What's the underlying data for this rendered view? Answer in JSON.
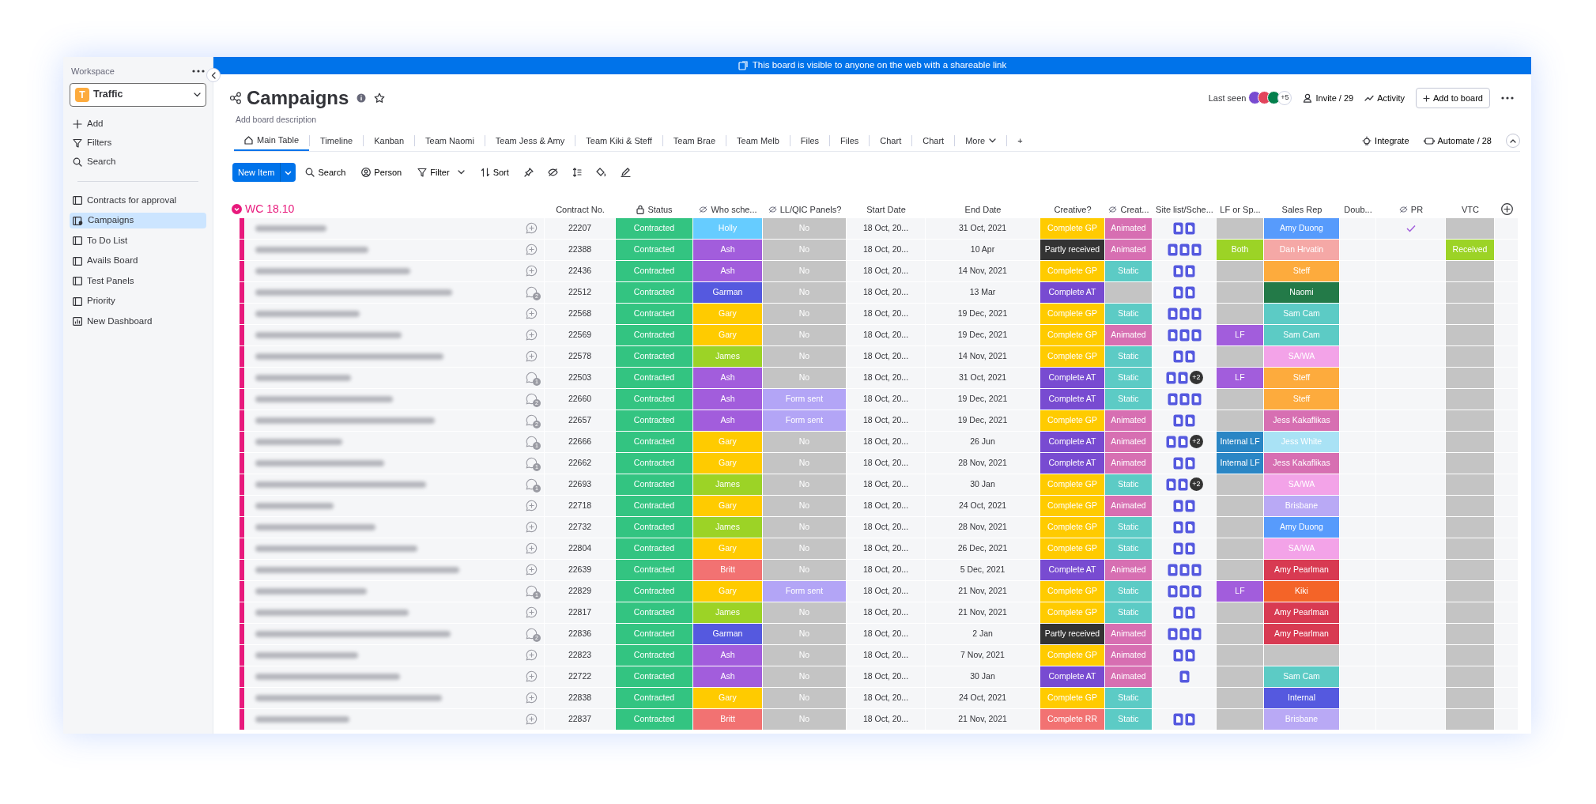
{
  "banner": "This board is visible to anyone on the web with a shareable link",
  "sidebar": {
    "heading": "Workspace",
    "workspace": {
      "badge": "T",
      "name": "Traffic"
    },
    "actions": [
      "Add",
      "Filters",
      "Search"
    ],
    "boards": [
      {
        "label": "Contracts for approval",
        "kind": "board",
        "selected": false
      },
      {
        "label": "Campaigns",
        "kind": "shared",
        "selected": true
      },
      {
        "label": "To Do List",
        "kind": "board",
        "selected": false
      },
      {
        "label": "Avails Board",
        "kind": "board",
        "selected": false
      },
      {
        "label": "Test Panels",
        "kind": "board",
        "selected": false
      },
      {
        "label": "Priority",
        "kind": "board",
        "selected": false
      },
      {
        "label": "New Dashboard",
        "kind": "dashboard",
        "selected": false
      }
    ]
  },
  "board": {
    "title": "Campaigns",
    "description": "Add board description",
    "last_seen": "Last seen",
    "avatars": [
      {
        "color": "#784bd1"
      },
      {
        "color": "#e2445c"
      },
      {
        "color": "#037f4c"
      }
    ],
    "more_viewers": "+5",
    "invite": "Invite / 29",
    "activity": "Activity",
    "add_to_board": "Add to board"
  },
  "tabs": [
    {
      "label": "Main Table",
      "selected": true,
      "kind": "home"
    },
    {
      "label": "Timeline",
      "selected": false,
      "kind": "view"
    },
    {
      "label": "Kanban",
      "selected": false,
      "kind": "view"
    },
    {
      "label": "Team Naomi",
      "selected": false,
      "kind": "view"
    },
    {
      "label": "Team Jess & Amy",
      "selected": false,
      "kind": "view"
    },
    {
      "label": "Team Kiki & Steff",
      "selected": false,
      "kind": "view"
    },
    {
      "label": "Team Brae",
      "selected": false,
      "kind": "view"
    },
    {
      "label": "Team Melb",
      "selected": false,
      "kind": "view"
    },
    {
      "label": "Files",
      "selected": false,
      "kind": "view"
    },
    {
      "label": "Files",
      "selected": false,
      "kind": "view"
    },
    {
      "label": "Chart",
      "selected": false,
      "kind": "view"
    },
    {
      "label": "Chart",
      "selected": false,
      "kind": "view"
    },
    {
      "label": "More",
      "selected": false,
      "kind": "menu"
    },
    {
      "label": "+",
      "selected": false,
      "kind": "add"
    }
  ],
  "tab_actions": [
    "Integrate",
    "Automate / 28"
  ],
  "toolbar": {
    "new_item": "New Item",
    "tools": [
      {
        "label": "Search",
        "kind": "search"
      },
      {
        "label": "Person",
        "kind": "person"
      },
      {
        "label": "Filter",
        "kind": "filter"
      },
      {
        "label": "Sort",
        "kind": "sort"
      }
    ]
  },
  "group": {
    "title": "WC 18.10",
    "color": "#e8197c"
  },
  "columns": [
    {
      "label": "Contract No."
    },
    {
      "label": "Status",
      "locked": true
    },
    {
      "label": "Who sche...",
      "private": true
    },
    {
      "label": "LL/QIC Panels?",
      "private": true
    },
    {
      "label": "Start Date"
    },
    {
      "label": "End Date"
    },
    {
      "label": "Creative?"
    },
    {
      "label": "Creat...",
      "private": true
    },
    {
      "label": "Site list/Sche..."
    },
    {
      "label": "LF or Sp..."
    },
    {
      "label": "Sales Rep"
    },
    {
      "label": "Doub..."
    },
    {
      "label": "PR",
      "private": true
    },
    {
      "label": "VTC"
    }
  ],
  "rows": [
    {
      "name_redacted": true,
      "contract": "22207",
      "status": {
        "text": "Contracted",
        "color": "#33c481"
      },
      "who": {
        "text": "Holly",
        "color": "#66ccff"
      },
      "panels": {
        "text": "No",
        "color": "#c4c4c4"
      },
      "start": "18 Oct, 20...",
      "end": "31 Oct, 2021",
      "creative": {
        "text": "Complete GP",
        "color": "#ffcb00"
      },
      "creat": {
        "text": "Animated",
        "color": "#d76fb2"
      },
      "files": [
        {
          "kind": "doc"
        },
        {
          "kind": "doc"
        }
      ],
      "lf": null,
      "sales_rep": {
        "text": "Amy Duong",
        "color": "#579bfc"
      },
      "pr_checked": true,
      "vtc": null
    },
    {
      "name_redacted": true,
      "contract": "22388",
      "status": {
        "text": "Contracted",
        "color": "#33c481"
      },
      "who": {
        "text": "Ash",
        "color": "#a25ddc"
      },
      "panels": {
        "text": "No",
        "color": "#c4c4c4"
      },
      "start": "18 Oct, 20...",
      "end": "10 Apr",
      "creative": {
        "text": "Partly received",
        "color": "#333333"
      },
      "creat": {
        "text": "Animated",
        "color": "#d76fb2"
      },
      "files": [
        {
          "kind": "doc"
        },
        {
          "kind": "doc"
        },
        {
          "kind": "doc"
        }
      ],
      "lf": {
        "text": "Both",
        "color": "#9cd326"
      },
      "sales_rep": {
        "text": "Dan Hrvatin",
        "color": "#f5a8a6"
      },
      "pr_checked": false,
      "vtc": {
        "text": "Received",
        "color": "#9cd326"
      }
    },
    {
      "name_redacted": true,
      "contract": "22436",
      "status": {
        "text": "Contracted",
        "color": "#33c481"
      },
      "who": {
        "text": "Ash",
        "color": "#a25ddc"
      },
      "panels": {
        "text": "No",
        "color": "#c4c4c4"
      },
      "start": "18 Oct, 20...",
      "end": "14 Nov, 2021",
      "creative": {
        "text": "Complete GP",
        "color": "#ffcb00"
      },
      "creat": {
        "text": "Static",
        "color": "#5ccbc5"
      },
      "files": [
        {
          "kind": "doc"
        },
        {
          "kind": "doc"
        }
      ],
      "lf": null,
      "sales_rep": {
        "text": "Steff",
        "color": "#fdab3d"
      },
      "pr_checked": false,
      "vtc": null
    },
    {
      "name_redacted": true,
      "updates": "2",
      "contract": "22512",
      "status": {
        "text": "Contracted",
        "color": "#33c481"
      },
      "who": {
        "text": "Garman",
        "color": "#5559df"
      },
      "panels": {
        "text": "No",
        "color": "#c4c4c4"
      },
      "start": "18 Oct, 20...",
      "end": "13 Mar",
      "creative": {
        "text": "Complete AT",
        "color": "#784bd1"
      },
      "creat": null,
      "files": [
        {
          "kind": "doc"
        },
        {
          "kind": "doc"
        }
      ],
      "lf": null,
      "sales_rep": {
        "text": "Naomi",
        "color": "#237a48"
      },
      "pr_checked": false,
      "vtc": null
    },
    {
      "name_redacted": true,
      "contract": "22568",
      "status": {
        "text": "Contracted",
        "color": "#33c481"
      },
      "who": {
        "text": "Gary",
        "color": "#ffcb00"
      },
      "panels": {
        "text": "No",
        "color": "#c4c4c4"
      },
      "start": "18 Oct, 20...",
      "end": "19 Dec, 2021",
      "creative": {
        "text": "Complete GP",
        "color": "#ffcb00"
      },
      "creat": {
        "text": "Static",
        "color": "#5ccbc5"
      },
      "files": [
        {
          "kind": "doc"
        },
        {
          "kind": "doc"
        },
        {
          "kind": "doc"
        }
      ],
      "lf": null,
      "sales_rep": {
        "text": "Sam Cam",
        "color": "#5ccbc5"
      },
      "pr_checked": false,
      "vtc": null
    },
    {
      "name_redacted": true,
      "contract": "22569",
      "status": {
        "text": "Contracted",
        "color": "#33c481"
      },
      "who": {
        "text": "Gary",
        "color": "#ffcb00"
      },
      "panels": {
        "text": "No",
        "color": "#c4c4c4"
      },
      "start": "18 Oct, 20...",
      "end": "19 Dec, 2021",
      "creative": {
        "text": "Complete GP",
        "color": "#ffcb00"
      },
      "creat": {
        "text": "Animated",
        "color": "#d76fb2"
      },
      "files": [
        {
          "kind": "doc"
        },
        {
          "kind": "doc"
        },
        {
          "kind": "doc"
        }
      ],
      "lf": {
        "text": "LF",
        "color": "#a25ddc"
      },
      "sales_rep": {
        "text": "Sam Cam",
        "color": "#5ccbc5"
      },
      "pr_checked": false,
      "vtc": null
    },
    {
      "name_redacted": true,
      "contract": "22578",
      "status": {
        "text": "Contracted",
        "color": "#33c481"
      },
      "who": {
        "text": "James",
        "color": "#9cd326"
      },
      "panels": {
        "text": "No",
        "color": "#c4c4c4"
      },
      "start": "18 Oct, 20...",
      "end": "14 Nov, 2021",
      "creative": {
        "text": "Complete GP",
        "color": "#ffcb00"
      },
      "creat": {
        "text": "Static",
        "color": "#5ccbc5"
      },
      "files": [
        {
          "kind": "doc"
        },
        {
          "kind": "doc"
        }
      ],
      "lf": null,
      "sales_rep": {
        "text": "SA/WA",
        "color": "#f3a3e8"
      },
      "pr_checked": false,
      "vtc": null
    },
    {
      "name_redacted": true,
      "updates": "1",
      "contract": "22503",
      "status": {
        "text": "Contracted",
        "color": "#33c481"
      },
      "who": {
        "text": "Ash",
        "color": "#a25ddc"
      },
      "panels": {
        "text": "No",
        "color": "#c4c4c4"
      },
      "start": "18 Oct, 20...",
      "end": "31 Oct, 2021",
      "creative": {
        "text": "Complete AT",
        "color": "#784bd1"
      },
      "creat": {
        "text": "Static",
        "color": "#5ccbc5"
      },
      "files": [
        {
          "kind": "doc"
        },
        {
          "kind": "doc"
        }
      ],
      "more_files": "+2",
      "lf": {
        "text": "LF",
        "color": "#a25ddc"
      },
      "sales_rep": {
        "text": "Steff",
        "color": "#fdab3d"
      },
      "pr_checked": false,
      "vtc": null
    },
    {
      "name_redacted": true,
      "updates": "2",
      "contract": "22660",
      "status": {
        "text": "Contracted",
        "color": "#33c481"
      },
      "who": {
        "text": "Ash",
        "color": "#a25ddc"
      },
      "panels": {
        "text": "Form sent",
        "color": "#b3a5f6"
      },
      "start": "18 Oct, 20...",
      "end": "19 Dec, 2021",
      "creative": {
        "text": "Complete AT",
        "color": "#784bd1"
      },
      "creat": {
        "text": "Static",
        "color": "#5ccbc5"
      },
      "files": [
        {
          "kind": "doc"
        },
        {
          "kind": "doc"
        },
        {
          "kind": "doc"
        }
      ],
      "lf": null,
      "sales_rep": {
        "text": "Steff",
        "color": "#fdab3d"
      },
      "pr_checked": false,
      "vtc": null
    },
    {
      "name_redacted": true,
      "updates": "2",
      "contract": "22657",
      "status": {
        "text": "Contracted",
        "color": "#33c481"
      },
      "who": {
        "text": "Ash",
        "color": "#a25ddc"
      },
      "panels": {
        "text": "Form sent",
        "color": "#b3a5f6"
      },
      "start": "18 Oct, 20...",
      "end": "19 Dec, 2021",
      "creative": {
        "text": "Complete GP",
        "color": "#ffcb00"
      },
      "creat": {
        "text": "Animated",
        "color": "#d76fb2"
      },
      "files": [
        {
          "kind": "doc"
        },
        {
          "kind": "doc"
        }
      ],
      "lf": null,
      "sales_rep": {
        "text": "Jess Kakaflikas",
        "color": "#d76fb2"
      },
      "pr_checked": false,
      "vtc": null
    },
    {
      "name_redacted": true,
      "updates": "1",
      "contract": "22666",
      "status": {
        "text": "Contracted",
        "color": "#33c481"
      },
      "who": {
        "text": "Gary",
        "color": "#ffcb00"
      },
      "panels": {
        "text": "No",
        "color": "#c4c4c4"
      },
      "start": "18 Oct, 20...",
      "end": "26 Jun",
      "creative": {
        "text": "Complete AT",
        "color": "#784bd1"
      },
      "creat": {
        "text": "Animated",
        "color": "#d76fb2"
      },
      "files": [
        {
          "kind": "doc"
        },
        {
          "kind": "doc"
        }
      ],
      "more_files": "+2",
      "lf": {
        "text": "Internal LF",
        "color": "#2a86c5"
      },
      "sales_rep": {
        "text": "Jess White",
        "color": "#a9e2f5"
      },
      "pr_checked": false,
      "vtc": null
    },
    {
      "name_redacted": true,
      "updates": "1",
      "contract": "22662",
      "status": {
        "text": "Contracted",
        "color": "#33c481"
      },
      "who": {
        "text": "Gary",
        "color": "#ffcb00"
      },
      "panels": {
        "text": "No",
        "color": "#c4c4c4"
      },
      "start": "18 Oct, 20...",
      "end": "28 Nov, 2021",
      "creative": {
        "text": "Complete AT",
        "color": "#784bd1"
      },
      "creat": {
        "text": "Animated",
        "color": "#d76fb2"
      },
      "files": [
        {
          "kind": "doc"
        },
        {
          "kind": "doc"
        }
      ],
      "lf": {
        "text": "Internal LF",
        "color": "#2a86c5"
      },
      "sales_rep": {
        "text": "Jess Kakaflikas",
        "color": "#d76fb2"
      },
      "pr_checked": false,
      "vtc": null
    },
    {
      "name_redacted": true,
      "updates": "1",
      "contract": "22693",
      "status": {
        "text": "Contracted",
        "color": "#33c481"
      },
      "who": {
        "text": "James",
        "color": "#9cd326"
      },
      "panels": {
        "text": "No",
        "color": "#c4c4c4"
      },
      "start": "18 Oct, 20...",
      "end": "30 Jan",
      "creative": {
        "text": "Complete GP",
        "color": "#ffcb00"
      },
      "creat": {
        "text": "Static",
        "color": "#5ccbc5"
      },
      "files": [
        {
          "kind": "doc"
        },
        {
          "kind": "doc"
        }
      ],
      "more_files": "+2",
      "lf": null,
      "sales_rep": {
        "text": "SA/WA",
        "color": "#f3a3e8"
      },
      "pr_checked": false,
      "vtc": null
    },
    {
      "name_redacted": true,
      "contract": "22718",
      "status": {
        "text": "Contracted",
        "color": "#33c481"
      },
      "who": {
        "text": "Gary",
        "color": "#ffcb00"
      },
      "panels": {
        "text": "No",
        "color": "#c4c4c4"
      },
      "start": "18 Oct, 20...",
      "end": "24 Oct, 2021",
      "creative": {
        "text": "Complete GP",
        "color": "#ffcb00"
      },
      "creat": {
        "text": "Animated",
        "color": "#d76fb2"
      },
      "files": [
        {
          "kind": "doc"
        },
        {
          "kind": "doc"
        }
      ],
      "lf": null,
      "sales_rep": {
        "text": "Brisbane",
        "color": "#b9a9f5"
      },
      "pr_checked": false,
      "vtc": null
    },
    {
      "name_redacted": true,
      "contract": "22732",
      "status": {
        "text": "Contracted",
        "color": "#33c481"
      },
      "who": {
        "text": "James",
        "color": "#9cd326"
      },
      "panels": {
        "text": "No",
        "color": "#c4c4c4"
      },
      "start": "18 Oct, 20...",
      "end": "28 Nov, 2021",
      "creative": {
        "text": "Complete GP",
        "color": "#ffcb00"
      },
      "creat": {
        "text": "Static",
        "color": "#5ccbc5"
      },
      "files": [
        {
          "kind": "doc"
        },
        {
          "kind": "doc"
        }
      ],
      "lf": null,
      "sales_rep": {
        "text": "Amy Duong",
        "color": "#579bfc"
      },
      "pr_checked": false,
      "vtc": null
    },
    {
      "name_redacted": true,
      "contract": "22804",
      "status": {
        "text": "Contracted",
        "color": "#33c481"
      },
      "who": {
        "text": "Gary",
        "color": "#ffcb00"
      },
      "panels": {
        "text": "No",
        "color": "#c4c4c4"
      },
      "start": "18 Oct, 20...",
      "end": "26 Dec, 2021",
      "creative": {
        "text": "Complete GP",
        "color": "#ffcb00"
      },
      "creat": {
        "text": "Static",
        "color": "#5ccbc5"
      },
      "files": [
        {
          "kind": "doc"
        },
        {
          "kind": "doc"
        }
      ],
      "lf": null,
      "sales_rep": {
        "text": "SA/WA",
        "color": "#f3a3e8"
      },
      "pr_checked": false,
      "vtc": null
    },
    {
      "name_redacted": true,
      "contract": "22639",
      "status": {
        "text": "Contracted",
        "color": "#33c481"
      },
      "who": {
        "text": "Britt",
        "color": "#f27272"
      },
      "panels": {
        "text": "No",
        "color": "#c4c4c4"
      },
      "start": "18 Oct, 20...",
      "end": "5 Dec, 2021",
      "creative": {
        "text": "Complete AT",
        "color": "#784bd1"
      },
      "creat": {
        "text": "Animated",
        "color": "#d76fb2"
      },
      "files": [
        {
          "kind": "doc"
        },
        {
          "kind": "doc"
        },
        {
          "kind": "doc"
        }
      ],
      "lf": null,
      "sales_rep": {
        "text": "Amy Pearlman",
        "color": "#d83a52"
      },
      "pr_checked": false,
      "vtc": null
    },
    {
      "name_redacted": true,
      "updates": "1",
      "contract": "22829",
      "status": {
        "text": "Contracted",
        "color": "#33c481"
      },
      "who": {
        "text": "Gary",
        "color": "#ffcb00"
      },
      "panels": {
        "text": "Form sent",
        "color": "#b3a5f6"
      },
      "start": "18 Oct, 20...",
      "end": "21 Nov, 2021",
      "creative": {
        "text": "Complete GP",
        "color": "#ffcb00"
      },
      "creat": {
        "text": "Static",
        "color": "#5ccbc5"
      },
      "files": [
        {
          "kind": "doc"
        },
        {
          "kind": "doc"
        },
        {
          "kind": "doc"
        }
      ],
      "lf": {
        "text": "LF",
        "color": "#a25ddc"
      },
      "sales_rep": {
        "text": "Kiki",
        "color": "#f46428"
      },
      "pr_checked": false,
      "vtc": null
    },
    {
      "name_redacted": true,
      "contract": "22817",
      "status": {
        "text": "Contracted",
        "color": "#33c481"
      },
      "who": {
        "text": "James",
        "color": "#9cd326"
      },
      "panels": {
        "text": "No",
        "color": "#c4c4c4"
      },
      "start": "18 Oct, 20...",
      "end": "21 Nov, 2021",
      "creative": {
        "text": "Complete GP",
        "color": "#ffcb00"
      },
      "creat": {
        "text": "Static",
        "color": "#5ccbc5"
      },
      "files": [
        {
          "kind": "doc"
        },
        {
          "kind": "doc"
        }
      ],
      "lf": null,
      "sales_rep": {
        "text": "Amy Pearlman",
        "color": "#d83a52"
      },
      "pr_checked": false,
      "vtc": null
    },
    {
      "name_redacted": true,
      "updates": "2",
      "contract": "22836",
      "status": {
        "text": "Contracted",
        "color": "#33c481"
      },
      "who": {
        "text": "Garman",
        "color": "#5559df"
      },
      "panels": {
        "text": "No",
        "color": "#c4c4c4"
      },
      "start": "18 Oct, 20...",
      "end": "2 Jan",
      "creative": {
        "text": "Partly received",
        "color": "#333333"
      },
      "creat": {
        "text": "Animated",
        "color": "#d76fb2"
      },
      "files": [
        {
          "kind": "doc"
        },
        {
          "kind": "doc"
        },
        {
          "kind": "doc"
        }
      ],
      "lf": null,
      "sales_rep": {
        "text": "Amy Pearlman",
        "color": "#d83a52"
      },
      "pr_checked": false,
      "vtc": null
    },
    {
      "name_redacted": true,
      "contract": "22823",
      "status": {
        "text": "Contracted",
        "color": "#33c481"
      },
      "who": {
        "text": "Ash",
        "color": "#a25ddc"
      },
      "panels": {
        "text": "No",
        "color": "#c4c4c4"
      },
      "start": "18 Oct, 20...",
      "end": "7 Nov, 2021",
      "creative": {
        "text": "Complete GP",
        "color": "#ffcb00"
      },
      "creat": {
        "text": "Animated",
        "color": "#d76fb2"
      },
      "files": [
        {
          "kind": "doc"
        },
        {
          "kind": "doc"
        }
      ],
      "lf": null,
      "sales_rep": null,
      "pr_checked": false,
      "vtc": null
    },
    {
      "name_redacted": true,
      "contract": "22722",
      "status": {
        "text": "Contracted",
        "color": "#33c481"
      },
      "who": {
        "text": "Ash",
        "color": "#a25ddc"
      },
      "panels": {
        "text": "No",
        "color": "#c4c4c4"
      },
      "start": "18 Oct, 20...",
      "end": "30 Jan",
      "creative": {
        "text": "Complete AT",
        "color": "#784bd1"
      },
      "creat": {
        "text": "Animated",
        "color": "#d76fb2"
      },
      "files": [
        {
          "kind": "doc"
        }
      ],
      "lf": null,
      "sales_rep": {
        "text": "Sam Cam",
        "color": "#5ccbc5"
      },
      "pr_checked": false,
      "vtc": null
    },
    {
      "name_redacted": true,
      "contract": "22838",
      "status": {
        "text": "Contracted",
        "color": "#33c481"
      },
      "who": {
        "text": "Gary",
        "color": "#ffcb00"
      },
      "panels": {
        "text": "No",
        "color": "#c4c4c4"
      },
      "start": "18 Oct, 20...",
      "end": "24 Oct, 2021",
      "creative": {
        "text": "Complete GP",
        "color": "#ffcb00"
      },
      "creat": {
        "text": "Static",
        "color": "#5ccbc5"
      },
      "lf": null,
      "sales_rep": {
        "text": "Internal",
        "color": "#5559df"
      },
      "pr_checked": false,
      "vtc": null
    },
    {
      "name_redacted": true,
      "contract": "22837",
      "status": {
        "text": "Contracted",
        "color": "#33c481"
      },
      "who": {
        "text": "Britt",
        "color": "#f27272"
      },
      "panels": {
        "text": "No",
        "color": "#c4c4c4"
      },
      "start": "18 Oct, 20...",
      "end": "21 Nov, 2021",
      "creative": {
        "text": "Complete RR",
        "color": "#f27272"
      },
      "creat": {
        "text": "Static",
        "color": "#5ccbc5"
      },
      "files": [
        {
          "kind": "doc"
        },
        {
          "kind": "doc"
        }
      ],
      "lf": null,
      "sales_rep": {
        "text": "Brisbane",
        "color": "#b9a9f5"
      },
      "pr_checked": false,
      "vtc": null
    }
  ]
}
